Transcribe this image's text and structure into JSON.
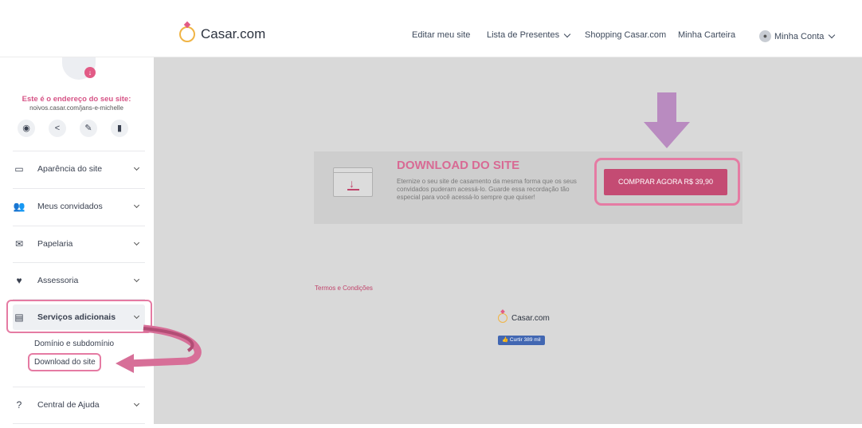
{
  "header": {
    "logo_text": "Casar.com",
    "nav": {
      "edit_site": "Editar meu site",
      "gift_list": "Lista de Presentes",
      "shopping": "Shopping Casar.com",
      "wallet": "Minha Carteira",
      "account": "Minha Conta"
    }
  },
  "sidebar": {
    "site_title": "Este é o endereço do seu site:",
    "site_url": "noivos.casar.com/jans-e-michelle",
    "tools": [
      "eye-icon",
      "share-icon",
      "pencil-icon",
      "copy-icon"
    ],
    "items": [
      {
        "label": "Aparência do site",
        "icon": "monitor-icon"
      },
      {
        "label": "Meus convidados",
        "icon": "people-icon"
      },
      {
        "label": "Papelaria",
        "icon": "envelope-icon"
      },
      {
        "label": "Assessoria",
        "icon": "heart-icon"
      },
      {
        "label": "Serviços adicionais",
        "icon": "card-icon"
      },
      {
        "label": "Central de Ajuda",
        "icon": "help-icon"
      }
    ],
    "sub_items": [
      "Domínio e subdomínio",
      "Download do site"
    ]
  },
  "main": {
    "banner": {
      "title": "DOWNLOAD DO SITE",
      "text": "Eternize o seu site de casamento da mesma forma que os seus convidados puderam acessá-lo. Guarde essa recordação tão especial para você acessá-lo sempre que quiser!",
      "button": "COMPRAR AGORA R$ 39,90"
    },
    "terms": "Termos e Condições",
    "footer_logo": "Casar.com",
    "fb_like": "Curtir 389 mil"
  },
  "colors": {
    "brand_pink": "#c44b73",
    "highlight": "#e57ba3",
    "arrow_purple": "#b98bc0",
    "main_bg": "#d9d9d9"
  }
}
